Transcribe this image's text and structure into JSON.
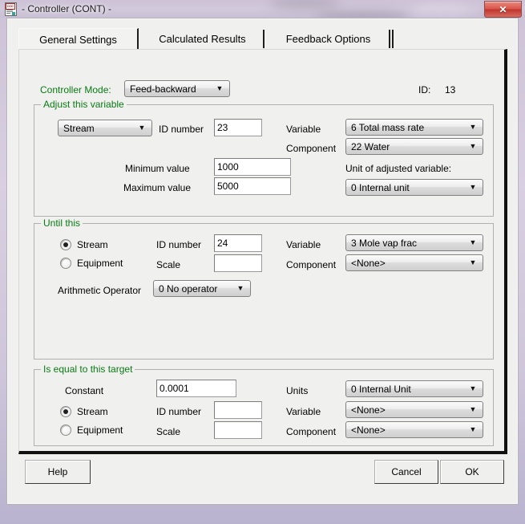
{
  "window": {
    "title": "- Controller (CONT) -",
    "icon": "document-doc-icon",
    "close_label": "✕"
  },
  "tabs": [
    {
      "label": "General Settings",
      "active": true
    },
    {
      "label": "Calculated Results",
      "active": false
    },
    {
      "label": "Feedback Options",
      "active": false
    }
  ],
  "header": {
    "controller_mode_label": "Controller Mode:",
    "controller_mode_value": "Feed-backward",
    "id_label": "ID:",
    "id_value": "13"
  },
  "adjust": {
    "group_title": "Adjust this variable",
    "object_type_value": "Stream",
    "id_number_label": "ID number",
    "id_number_value": "23",
    "minimum_label": "Minimum  value",
    "minimum_value": "1000",
    "maximum_label": "Maximum  value",
    "maximum_value": "5000",
    "variable_label": "Variable",
    "variable_value": "6 Total mass rate",
    "component_label": "Component",
    "component_value": "22 Water",
    "unit_label": "Unit of adjusted variable:",
    "unit_value": "0  Internal unit"
  },
  "until": {
    "group_title": "Until this",
    "radio_stream": "Stream",
    "radio_equipment": "Equipment",
    "selected_radio": "Stream",
    "id_number_label": "ID number",
    "id_number_value": "24",
    "scale_label": "Scale",
    "scale_value": "",
    "variable_label": "Variable",
    "variable_value": "3 Mole vap frac",
    "component_label": "Component",
    "component_value": "<None>",
    "arith_label": "Arithmetic Operator",
    "arith_value": "0 No operator"
  },
  "target": {
    "group_title": "Is equal to this target",
    "constant_label": "Constant",
    "constant_value": "0.0001",
    "radio_stream": "Stream",
    "radio_equipment": "Equipment",
    "selected_radio": "Stream",
    "id_number_label": "ID number",
    "id_number_value": "",
    "scale_label": "Scale",
    "scale_value": "",
    "units_label": "Units",
    "units_value": "0  Internal Unit",
    "variable_label": "Variable",
    "variable_value": "<None>",
    "component_label": "Component",
    "component_value": "<None>"
  },
  "buttons": {
    "help": "Help",
    "cancel": "Cancel",
    "ok": "OK"
  },
  "colors": {
    "group_title_green": "#0a7a15",
    "face": "#f0f0ee",
    "close_red": "#d9544a"
  },
  "icons": {
    "dropdown_arrow": "▼"
  }
}
